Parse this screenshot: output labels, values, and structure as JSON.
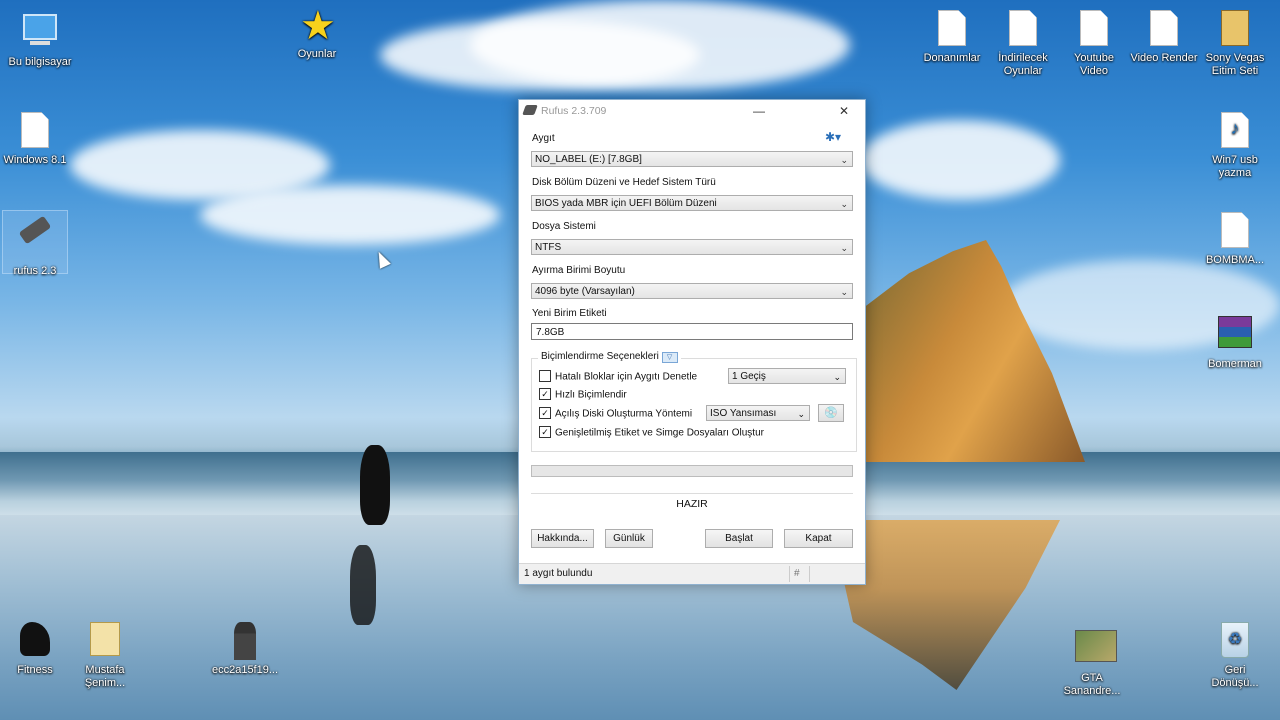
{
  "desktop": {
    "icons_left": [
      {
        "label": "Bu bilgisayar",
        "icon": "computer-icon"
      },
      {
        "label": "Windows 8.1",
        "icon": "disc-image-icon"
      },
      {
        "label": "rufus 2.3",
        "icon": "usb-drive-icon"
      }
    ],
    "icon_oyunlar": {
      "label": "Oyunlar",
      "icon": "star-icon"
    },
    "icons_top_right": [
      {
        "label": "Donanımlar",
        "icon": "document-icon"
      },
      {
        "label": "İndirilecek Oyunlar",
        "icon": "document-icon"
      },
      {
        "label": "Youtube Video",
        "icon": "document-icon"
      },
      {
        "label": "Video Render",
        "icon": "document-icon"
      },
      {
        "label": "Sony Vegas Eitim Seti",
        "icon": "folder-icon"
      }
    ],
    "icons_right": [
      {
        "label": "Win7 usb yazma",
        "icon": "m4a-file-icon"
      },
      {
        "label": "BOMBMA...",
        "icon": "document-icon"
      },
      {
        "label": "Bomerman",
        "icon": "archive-icon"
      }
    ],
    "icons_bottom": [
      {
        "label": "Fitness",
        "icon": "muscle-icon"
      },
      {
        "label": "Mustafa Şenim...",
        "icon": "folder-icon"
      },
      {
        "label": "ecc2a15f19...",
        "icon": "person-image-icon"
      },
      {
        "label": "GTA Sanandre...",
        "icon": "game-icon"
      },
      {
        "label": "Geri Dönüşü...",
        "icon": "recycle-bin-icon"
      }
    ]
  },
  "window": {
    "title": "Rufus 2.3.709",
    "minimize": "—",
    "close": "✕",
    "device_label": "Aygıt",
    "device_value": "NO_LABEL (E:) [7.8GB]",
    "partition_label": "Disk Bölüm Düzeni ve Hedef Sistem Türü",
    "partition_value": "BIOS yada MBR için UEFI Bölüm Düzeni",
    "filesystem_label": "Dosya Sistemi",
    "filesystem_value": "NTFS",
    "cluster_label": "Ayırma Birimi Boyutu",
    "cluster_value": "4096 byte (Varsayılan)",
    "volume_label": "Yeni Birim Etiketi",
    "volume_value": "7.8GB",
    "format_options_label": "Biçimlendirme Seçenekleri",
    "options": {
      "bad_blocks": {
        "label": "Hatalı Bloklar için Aygıtı Denetle",
        "checked": false,
        "passes": "1 Geçiş"
      },
      "quick_format": {
        "label": "Hızlı Biçimlendir",
        "checked": true
      },
      "bootable": {
        "label": "Açılış Diski Oluşturma Yöntemi",
        "checked": true,
        "method": "ISO Yansıması"
      },
      "extended_label": {
        "label": "Genişletilmiş Etiket ve Simge Dosyaları Oluştur",
        "checked": true
      }
    },
    "progress": 0,
    "status": "HAZIR",
    "buttons": {
      "about": "Hakkında...",
      "log": "Günlük",
      "start": "Başlat",
      "close": "Kapat"
    },
    "statusbar_text": "1 aygıt bulundu",
    "statusbar_hash": "#"
  }
}
